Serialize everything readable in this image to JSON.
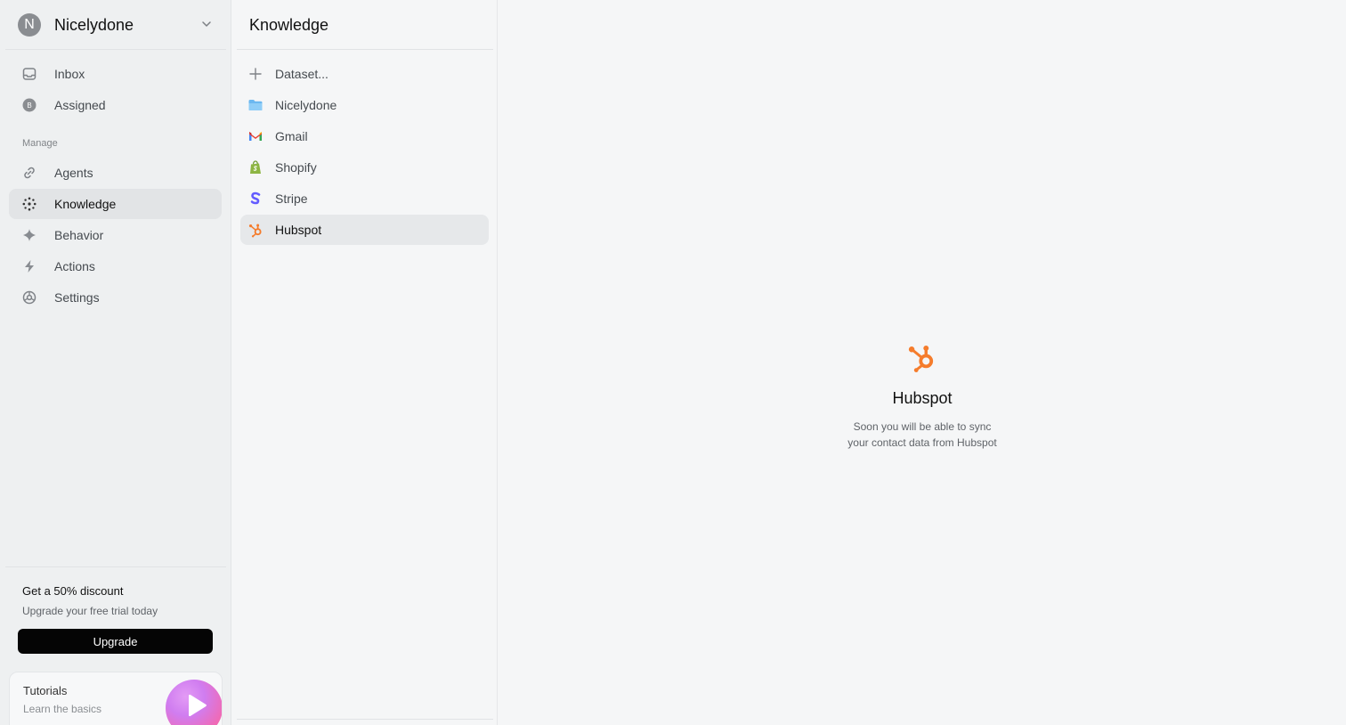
{
  "workspace": {
    "initial": "N",
    "name": "Nicelydone"
  },
  "sidebar": {
    "top_items": [
      {
        "label": "Inbox",
        "icon": "inbox-icon"
      },
      {
        "label": "Assigned",
        "icon": "assigned-badge-icon",
        "badge": "B"
      }
    ],
    "section_label": "Manage",
    "manage_items": [
      {
        "label": "Agents",
        "icon": "link-icon"
      },
      {
        "label": "Knowledge",
        "icon": "dots-circle-icon",
        "active": true
      },
      {
        "label": "Behavior",
        "icon": "sparkle-icon"
      },
      {
        "label": "Actions",
        "icon": "bolt-icon"
      },
      {
        "label": "Settings",
        "icon": "settings-icon"
      }
    ],
    "promo": {
      "title": "Get a 50% discount",
      "subtitle": "Upgrade your free trial today",
      "button": "Upgrade"
    },
    "tutorials": {
      "title": "Tutorials",
      "subtitle": "Learn the basics"
    }
  },
  "knowledge": {
    "title": "Knowledge",
    "items": [
      {
        "label": "Dataset...",
        "icon": "plus-icon"
      },
      {
        "label": "Nicelydone",
        "icon": "folder-icon"
      },
      {
        "label": "Gmail",
        "icon": "gmail-icon"
      },
      {
        "label": "Shopify",
        "icon": "shopify-icon"
      },
      {
        "label": "Stripe",
        "icon": "stripe-icon"
      },
      {
        "label": "Hubspot",
        "icon": "hubspot-icon",
        "active": true
      }
    ]
  },
  "detail": {
    "title": "Hubspot",
    "description_line1": "Soon you will be able to sync",
    "description_line2": "your contact data from Hubspot"
  },
  "colors": {
    "hubspot": "#f57c2c",
    "folder": "#6cb8f0",
    "shopify": "#8db543",
    "stripe": "#635bff",
    "upgrade_bg": "#050505"
  }
}
